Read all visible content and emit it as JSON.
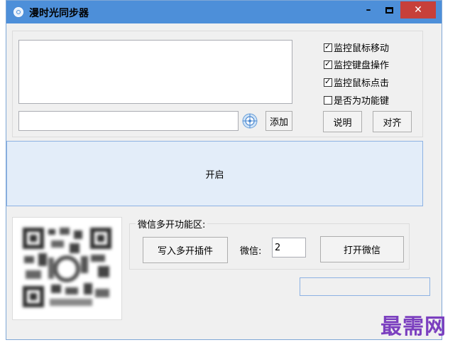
{
  "window": {
    "title": "漫时光同步器",
    "min_label": "–",
    "close_label": "✕"
  },
  "options": [
    {
      "label": "监控鼠标移动",
      "checked": true
    },
    {
      "label": "监控键盘操作",
      "checked": true
    },
    {
      "label": "监控鼠标点击",
      "checked": true
    },
    {
      "label": "是否为功能键",
      "checked": false
    }
  ],
  "key_input": {
    "value": ""
  },
  "buttons": {
    "add": "添加",
    "help": "说明",
    "align": "对齐",
    "start": "开启",
    "write_plugin": "写入多开插件",
    "open_wechat": "打开微信"
  },
  "wechat_group": {
    "title": "微信多开功能区:",
    "count_label": "微信:",
    "count_value": "2"
  },
  "watermark": "最需网",
  "icons": {
    "target": "crosshair-target-icon",
    "app": "app-clock-icon"
  },
  "colors": {
    "titlebar": "#4d8fd9",
    "close": "#c7403a",
    "start_bg": "#e3edf9",
    "watermark": "#7b3fbf"
  }
}
